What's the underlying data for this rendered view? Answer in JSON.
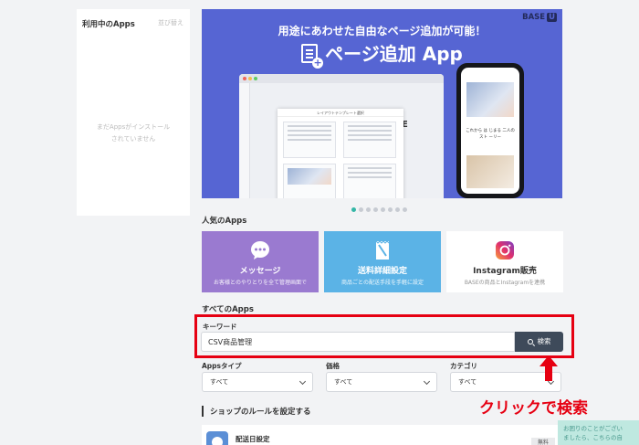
{
  "sidebar": {
    "title": "利用中のApps",
    "sort_label": "並び替え",
    "empty_line1": "まだAppsがインストール",
    "empty_line2": "されていません"
  },
  "banner": {
    "subtitle": "用途にあわせた自由なページ追加が可能！",
    "title": "ページ追加 App",
    "brand": "BASE",
    "brand_badge": "U",
    "modal_title": "レイアウトテンプレート選択",
    "phone_text": "これから は じまる 二人の スト ーリー"
  },
  "carousel": {
    "count": 8,
    "active_index": 0
  },
  "popular": {
    "heading": "人気のApps",
    "cards": [
      {
        "name": "メッセージ",
        "desc": "お客様とのやりとりを全て管理画面で",
        "icon": "speech-bubble-icon"
      },
      {
        "name": "送料詳細設定",
        "desc": "商品ごとの配送手段を手軽に設定",
        "icon": "shipping-label-icon"
      },
      {
        "name": "Instagram販売",
        "desc": "BASEの商品とInstagramを連携",
        "icon": "instagram-icon"
      }
    ]
  },
  "all_apps": {
    "heading": "すべてのApps",
    "keyword_label": "キーワード",
    "keyword_value": "CSV商品管理",
    "search_button": "検索",
    "filters": [
      {
        "label": "Appsタイプ",
        "value": "すべて"
      },
      {
        "label": "価格",
        "value": "すべて"
      },
      {
        "label": "カテゴリ",
        "value": "すべて"
      }
    ]
  },
  "annotation": {
    "text": "クリックで検索",
    "color": "#e60012"
  },
  "rules": {
    "heading": "ショップのルールを設定する",
    "item": {
      "name": "配送日設定",
      "badge": "無料"
    }
  },
  "help_widget": {
    "line1": "お困りのことがござい",
    "line2": "ましたら、こちらの自"
  },
  "colors": {
    "banner": "#5665d3",
    "message_card": "#9a7ad0",
    "shipping_card": "#5bb3e6",
    "search_button": "#3e4a5a",
    "carousel_active": "#34b6a6"
  }
}
